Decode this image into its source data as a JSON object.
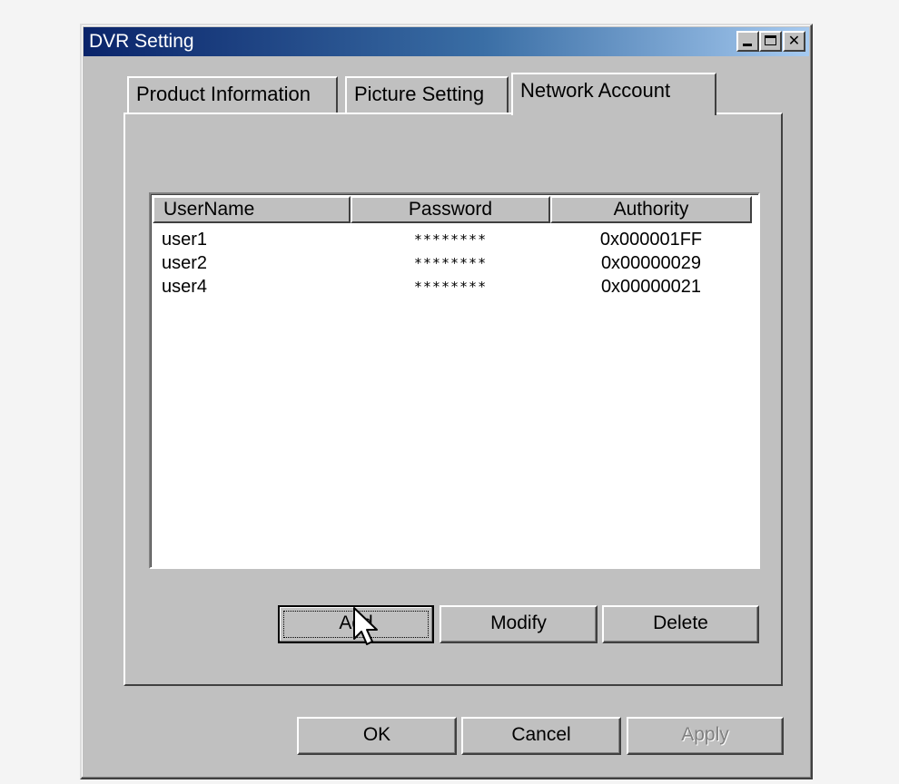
{
  "window": {
    "title": "DVR Setting"
  },
  "tabs": [
    {
      "label": "Product Information",
      "active": false
    },
    {
      "label": "Picture Setting",
      "active": false
    },
    {
      "label": "Network Account",
      "active": true
    }
  ],
  "accounts": {
    "columns": [
      "UserName",
      "Password",
      "Authority"
    ],
    "rows": [
      {
        "username": "user1",
        "password": "********",
        "authority": "0x000001FF"
      },
      {
        "username": "user2",
        "password": "********",
        "authority": "0x00000029"
      },
      {
        "username": "user4",
        "password": "********",
        "authority": "0x00000021"
      }
    ]
  },
  "account_buttons": {
    "add": "Add",
    "modify": "Modify",
    "delete": "Delete"
  },
  "dialog_buttons": {
    "ok": "OK",
    "cancel": "Cancel",
    "apply": "Apply",
    "apply_disabled": true
  },
  "colors": {
    "face": "#c0c0c0",
    "title_start": "#0a246a",
    "title_end": "#a6caf0",
    "list_bg": "#ffffff"
  },
  "icons": [
    "minimize-icon",
    "maximize-icon",
    "close-icon",
    "mouse-cursor-icon"
  ]
}
